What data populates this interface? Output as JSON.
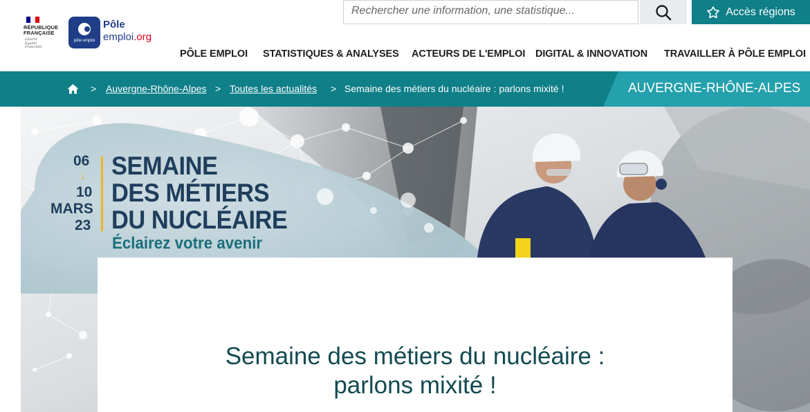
{
  "header": {
    "gov_logo": {
      "line1": "RÉPUBLIQUE",
      "line2": "FRANÇAISE",
      "motto1": "Liberté",
      "motto2": "Égalité",
      "motto3": "Fraternité",
      "flag_colors": [
        "#000091",
        "#ffffff",
        "#e1000f"
      ]
    },
    "brand": {
      "word1": "Pôle",
      "word2": "emploi",
      "word2_suffix": ".org",
      "badge_text": "pôle emploi",
      "color": "#1f3e87",
      "accent": "#e2001a"
    },
    "search": {
      "placeholder": "Rechercher une information, une statistique...",
      "icon": "search-icon"
    },
    "regions_button": {
      "label": "Accès régions",
      "icon": "map-icon",
      "color": "#0f7f88"
    },
    "nav": [
      "PÔLE EMPLOI",
      "STATISTIQUES & ANALYSES",
      "ACTEURS DE L'EMPLOI",
      "DIGITAL & INNOVATION",
      "TRAVAILLER À PÔLE EMPLOI"
    ]
  },
  "breadcrumb": {
    "home_icon": "home-icon",
    "items": [
      {
        "label": "Auvergne-Rhône-Alpes"
      },
      {
        "label": "Toutes les actualités"
      },
      {
        "label": "Semaine des métiers du nucléaire : parlons mixité !"
      }
    ],
    "separator": ">",
    "region": "AUVERGNE-RHÔNE-ALPES",
    "bar_color": "#0f7f88",
    "region_color": "#25a0ad"
  },
  "hero": {
    "date_start": "06",
    "date_end": "10",
    "month": "MARS",
    "year": "23",
    "title_line1": "SEMAINE",
    "title_line2": "DES MÉTIERS",
    "title_line3": "DU NUCLÉAIRE",
    "tagline": "Éclairez votre avenir",
    "colors": {
      "title": "#1f3e5c",
      "tagline": "#1b6f7b",
      "accent": "#f0b323"
    }
  },
  "article": {
    "title_line1": "Semaine des métiers du nucléaire :",
    "title_line2": "parlons mixité !",
    "color": "#124a51"
  }
}
